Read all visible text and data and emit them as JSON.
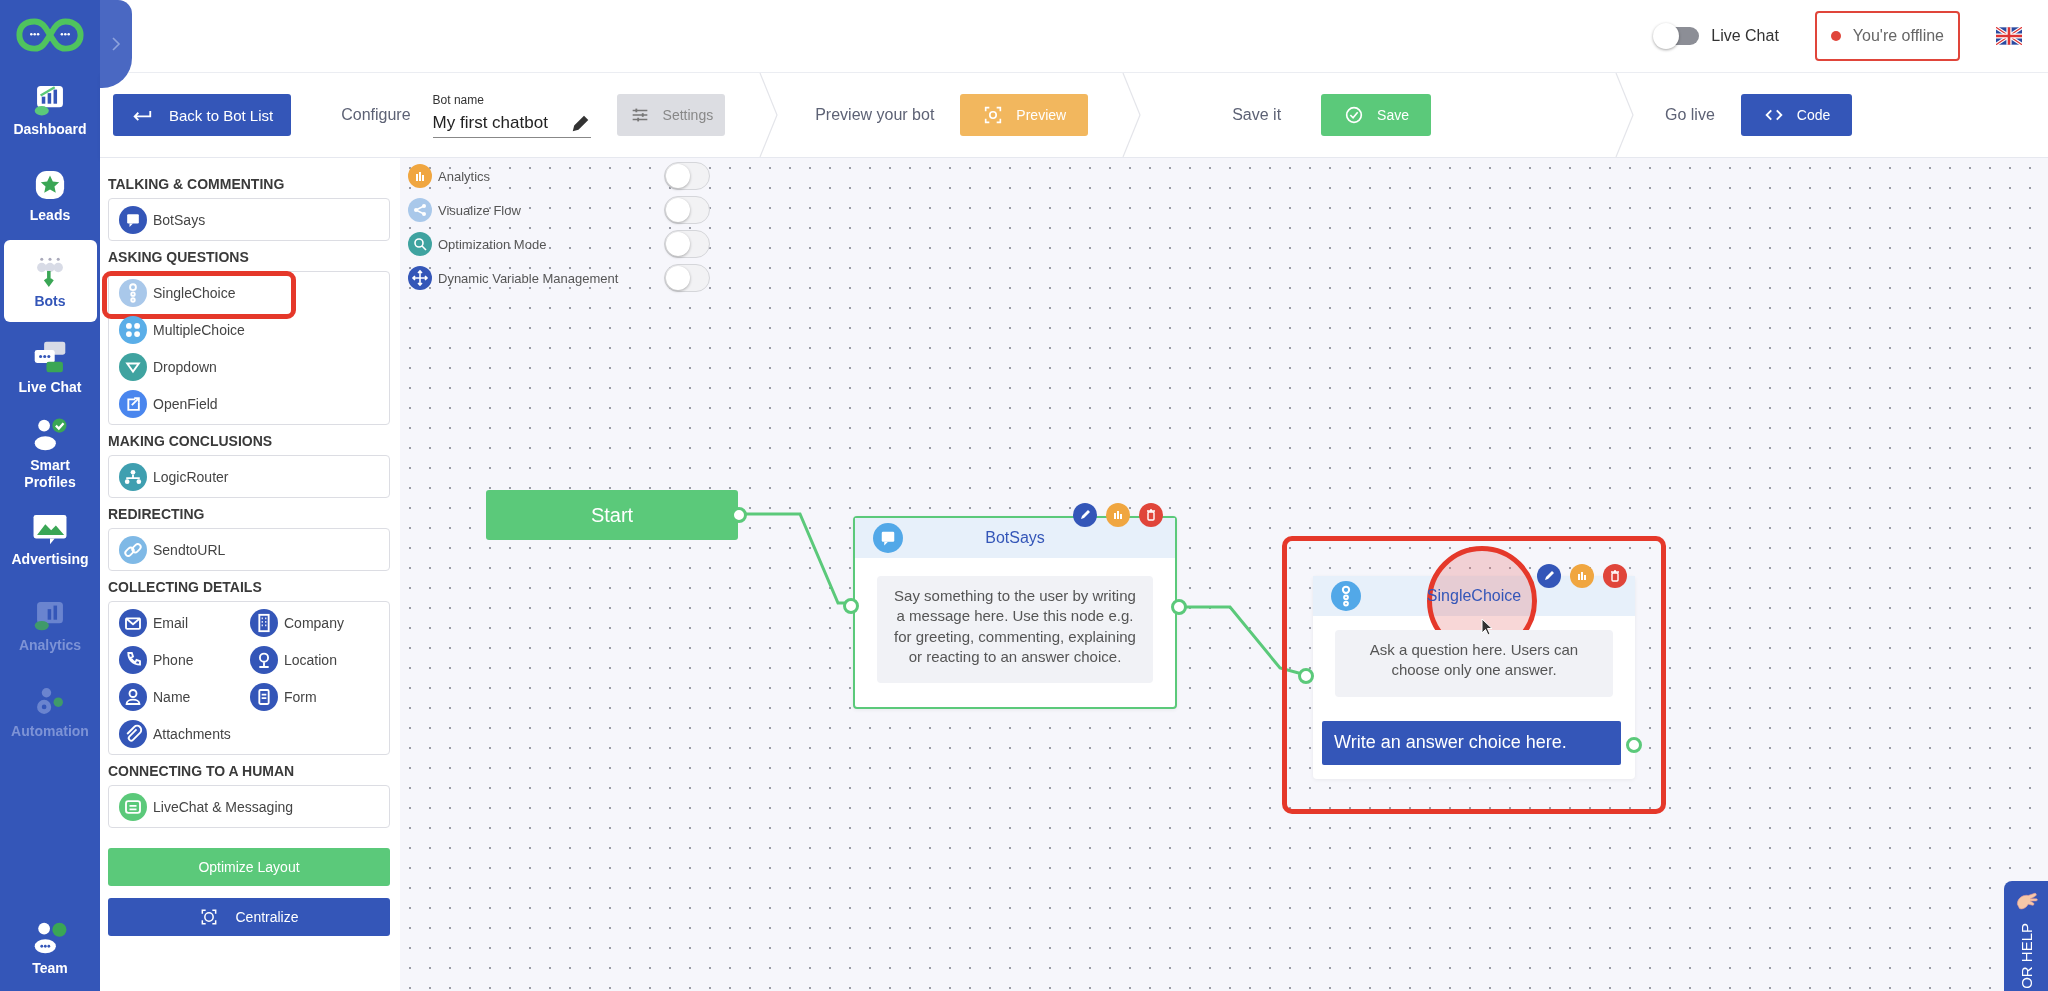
{
  "nav": {
    "items": [
      {
        "label": "Dashboard",
        "selected": false,
        "disabled": false
      },
      {
        "label": "Leads",
        "selected": false,
        "disabled": false
      },
      {
        "label": "Bots",
        "selected": true,
        "disabled": false
      },
      {
        "label": "Live Chat",
        "selected": false,
        "disabled": false
      },
      {
        "label": "Smart Profiles",
        "selected": false,
        "disabled": false
      },
      {
        "label": "Advertising",
        "selected": false,
        "disabled": false
      },
      {
        "label": "Analytics",
        "selected": false,
        "disabled": true
      },
      {
        "label": "Automation",
        "selected": false,
        "disabled": true
      }
    ],
    "bottom_item": {
      "label": "Team",
      "selected": false,
      "disabled": false
    }
  },
  "top_bar": {
    "live_chat": {
      "label": "Live Chat",
      "on": false
    },
    "status": {
      "label": "You're offline",
      "online": false,
      "highlighted": true
    }
  },
  "toolbar": {
    "back_button": "Back to Bot List",
    "steps": [
      {
        "kind": "configure",
        "label": "Configure",
        "field_label": "Bot name",
        "value": "My first chatbot",
        "button": "Settings",
        "color": "#dcdde2"
      },
      {
        "kind": "preview",
        "label": "Preview your bot",
        "button": "Preview",
        "color": "#f2b75e"
      },
      {
        "kind": "save",
        "label": "Save it",
        "button": "Save",
        "color": "#5bc97a"
      },
      {
        "kind": "code",
        "label": "Go live",
        "button": "Code",
        "color": "#3456b8"
      }
    ]
  },
  "palette": {
    "sections": [
      {
        "title": "TALKING & COMMENTING",
        "kind": "list",
        "items": [
          {
            "label": "BotSays",
            "color": "#3456b8",
            "highlighted": false
          }
        ]
      },
      {
        "title": "ASKING QUESTIONS",
        "kind": "list",
        "items": [
          {
            "label": "SingleChoice",
            "color": "#a9c8ea",
            "highlighted": true
          },
          {
            "label": "MultipleChoice",
            "color": "#5aaee8",
            "highlighted": false
          },
          {
            "label": "Dropdown",
            "color": "#3fa3a0",
            "highlighted": false
          },
          {
            "label": "OpenField",
            "color": "#4a86ee",
            "highlighted": false
          }
        ]
      },
      {
        "title": "MAKING CONCLUSIONS",
        "kind": "list",
        "items": [
          {
            "label": "LogicRouter",
            "color": "#3f9fb0",
            "highlighted": false
          }
        ]
      },
      {
        "title": "REDIRECTING",
        "kind": "list",
        "items": [
          {
            "label": "SendtoURL",
            "color": "#7fb9e6",
            "highlighted": false
          }
        ]
      },
      {
        "title": "COLLECTING DETAILS",
        "kind": "grid",
        "items": [
          {
            "label": "Email",
            "color": "#3456b8",
            "highlighted": false
          },
          {
            "label": "Company",
            "color": "#3456b8",
            "highlighted": false
          },
          {
            "label": "Phone",
            "color": "#3456b8",
            "highlighted": false
          },
          {
            "label": "Location",
            "color": "#3456b8",
            "highlighted": false
          },
          {
            "label": "Name",
            "color": "#3456b8",
            "highlighted": false
          },
          {
            "label": "Form",
            "color": "#3456b8",
            "highlighted": false
          },
          {
            "label": "Attachments",
            "color": "#3456b8",
            "highlighted": false
          }
        ]
      },
      {
        "title": "CONNECTING TO A HUMAN",
        "kind": "list",
        "items": [
          {
            "label": "LiveChat & Messaging",
            "color": "#5bc97a",
            "highlighted": false
          }
        ]
      }
    ],
    "buttons": [
      {
        "label": "Optimize Layout",
        "kind": "optimize"
      },
      {
        "label": "Centralize",
        "kind": "centralize"
      }
    ]
  },
  "canvas": {
    "toggles": [
      {
        "label": "Analytics",
        "on": false,
        "color": "#f0a640"
      },
      {
        "label": "Visualize Flow",
        "on": false,
        "color": "#a9c8ea"
      },
      {
        "label": "Optimization Mode",
        "on": false,
        "color": "#3fa3a0"
      },
      {
        "label": "Dynamic Variable Management",
        "on": false,
        "color": "#3456b8"
      }
    ],
    "start": {
      "label": "Start"
    },
    "nodes": [
      {
        "kind": "message",
        "title": "BotSays",
        "text": "Say something to the user by writing a message here. Use this node e.g. for greeting, commenting, explaining or reacting to an answer choice.",
        "selected": true,
        "highlighted": false
      },
      {
        "kind": "choice",
        "title": "SingleChoice",
        "text": "Ask a question here. Users can choose only one answer.",
        "answer": "Write an answer choice here.",
        "selected": false,
        "highlighted": true
      }
    ]
  },
  "help_tab": {
    "label": "OR HELP"
  }
}
